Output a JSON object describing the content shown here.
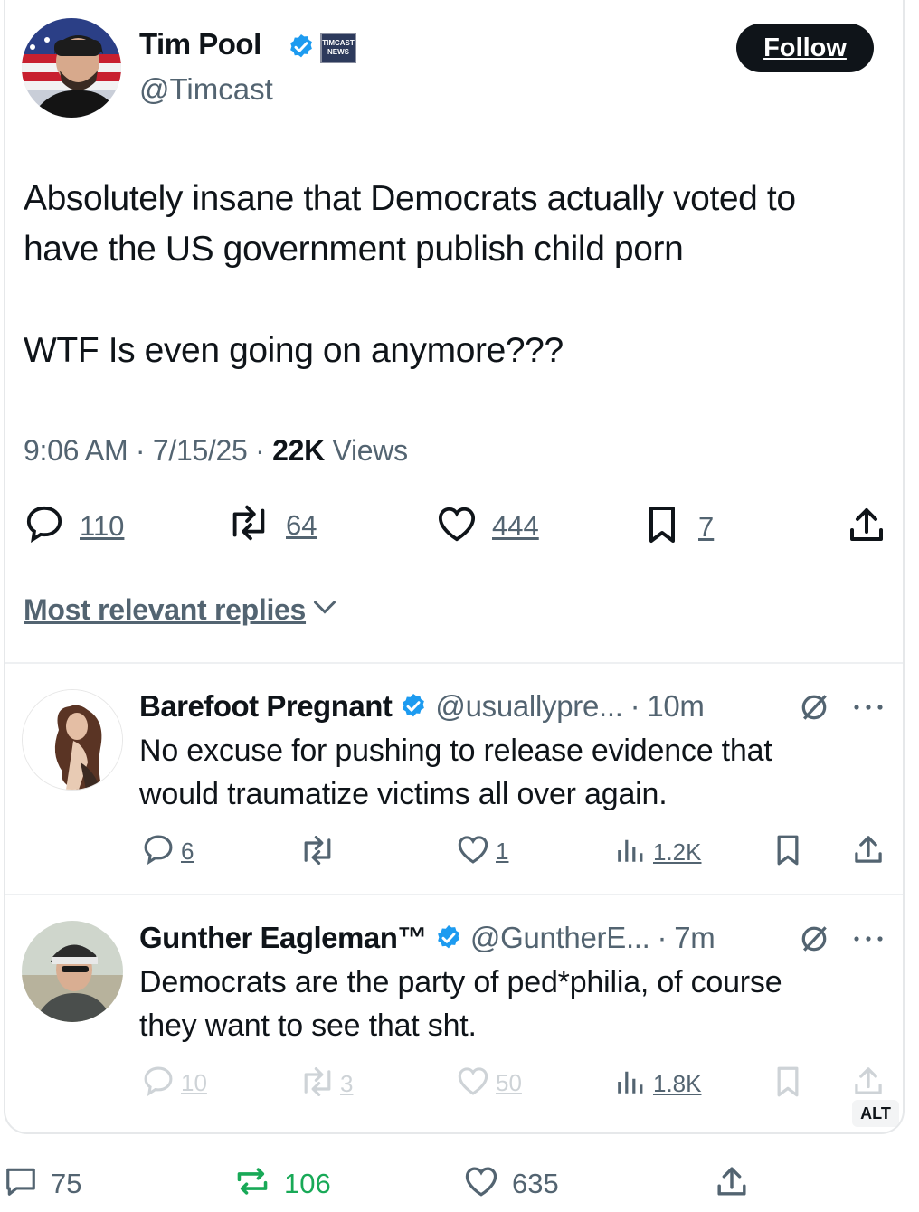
{
  "tweet": {
    "author_name": "Tim Pool",
    "handle": "@Timcast",
    "follow_label": "Follow",
    "text_line1": "Absolutely insane that Democrats actually voted to",
    "text_line2": "have the US government publish child porn",
    "text_line3": "WTF Is even going on anymore???",
    "time": "9:06 AM",
    "date": "7/15/25",
    "views_count": "22K",
    "views_label": "Views",
    "replies": "110",
    "reposts": "64",
    "likes": "444",
    "bookmarks": "7",
    "badge_label": "TIMCAST NEWS"
  },
  "replies_sort": "Most relevant replies",
  "replies": [
    {
      "name": "Barefoot Pregnant",
      "handle": "@usuallypre...",
      "time": "10m",
      "text_line1": "No excuse for pushing to release evidence that",
      "text_line2": "would traumatize victims all over again.",
      "replies": "6",
      "reposts": "",
      "likes": "1",
      "views": "1.2K"
    },
    {
      "name": "Gunther Eagleman™",
      "handle": "@GuntherE...",
      "time": "7m",
      "text_line1": "Democrats are the party of ped*philia, of course",
      "text_line2": "they want to see that sht.",
      "replies": "10",
      "reposts": "3",
      "likes": "50",
      "views": "1.8K",
      "alt_label": "ALT"
    }
  ],
  "outer_actions": {
    "replies": "75",
    "reposts": "106",
    "likes": "635"
  },
  "colors": {
    "verified": "#1d9bf0",
    "text": "#0f1419",
    "muted": "#536471",
    "repost_active": "#18a957"
  },
  "icons": [
    "verified-badge-icon",
    "reply-icon",
    "repost-icon",
    "like-icon",
    "bookmark-icon",
    "share-icon",
    "views-icon",
    "grok-icon",
    "more-icon",
    "chevron-down-icon"
  ]
}
